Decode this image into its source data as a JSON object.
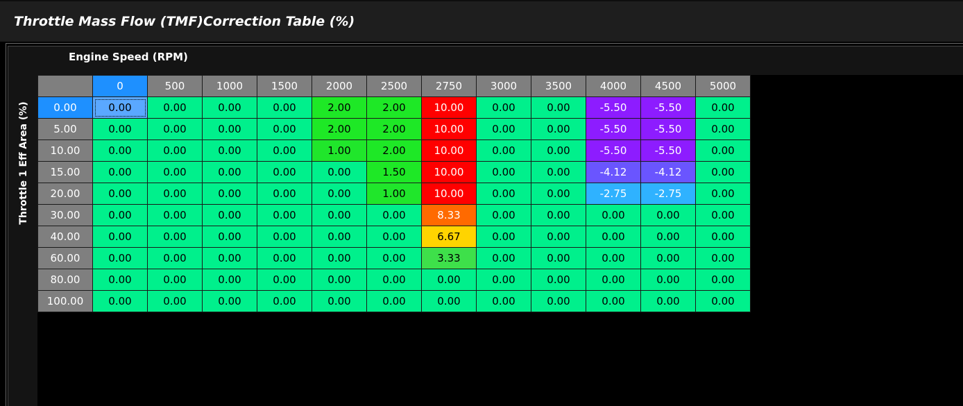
{
  "title": "Throttle Mass Flow (TMF)Correction Table (%)",
  "x_axis_label": "Engine Speed (RPM)",
  "y_axis_label": "Throttle 1 Eff Area (%)",
  "selected_column_index": 0,
  "selected_row_index": 0,
  "colors": {
    "header_bg": "#7f7f7f",
    "selected_header_bg": "#1e90ff",
    "selected_cell_bg": "#5aa8ff"
  },
  "columns": [
    "0",
    "500",
    "1000",
    "1500",
    "2000",
    "2500",
    "2750",
    "3000",
    "3500",
    "4000",
    "4500",
    "5000"
  ],
  "rows": [
    {
      "label": "0.00",
      "values": [
        "0.00",
        "0.00",
        "0.00",
        "0.00",
        "2.00",
        "2.00",
        "10.00",
        "0.00",
        "0.00",
        "-5.50",
        "-5.50",
        "0.00"
      ]
    },
    {
      "label": "5.00",
      "values": [
        "0.00",
        "0.00",
        "0.00",
        "0.00",
        "2.00",
        "2.00",
        "10.00",
        "0.00",
        "0.00",
        "-5.50",
        "-5.50",
        "0.00"
      ]
    },
    {
      "label": "10.00",
      "values": [
        "0.00",
        "0.00",
        "0.00",
        "0.00",
        "1.00",
        "2.00",
        "10.00",
        "0.00",
        "0.00",
        "-5.50",
        "-5.50",
        "0.00"
      ]
    },
    {
      "label": "15.00",
      "values": [
        "0.00",
        "0.00",
        "0.00",
        "0.00",
        "0.00",
        "1.50",
        "10.00",
        "0.00",
        "0.00",
        "-4.12",
        "-4.12",
        "0.00"
      ]
    },
    {
      "label": "20.00",
      "values": [
        "0.00",
        "0.00",
        "0.00",
        "0.00",
        "0.00",
        "1.00",
        "10.00",
        "0.00",
        "0.00",
        "-2.75",
        "-2.75",
        "0.00"
      ]
    },
    {
      "label": "30.00",
      "values": [
        "0.00",
        "0.00",
        "0.00",
        "0.00",
        "0.00",
        "0.00",
        "8.33",
        "0.00",
        "0.00",
        "0.00",
        "0.00",
        "0.00"
      ]
    },
    {
      "label": "40.00",
      "values": [
        "0.00",
        "0.00",
        "0.00",
        "0.00",
        "0.00",
        "0.00",
        "6.67",
        "0.00",
        "0.00",
        "0.00",
        "0.00",
        "0.00"
      ]
    },
    {
      "label": "60.00",
      "values": [
        "0.00",
        "0.00",
        "0.00",
        "0.00",
        "0.00",
        "0.00",
        "3.33",
        "0.00",
        "0.00",
        "0.00",
        "0.00",
        "0.00"
      ]
    },
    {
      "label": "80.00",
      "values": [
        "0.00",
        "0.00",
        "0.00",
        "0.00",
        "0.00",
        "0.00",
        "0.00",
        "0.00",
        "0.00",
        "0.00",
        "0.00",
        "0.00"
      ]
    },
    {
      "label": "100.00",
      "values": [
        "0.00",
        "0.00",
        "0.00",
        "0.00",
        "0.00",
        "0.00",
        "0.00",
        "0.00",
        "0.00",
        "0.00",
        "0.00",
        "0.00"
      ]
    }
  ]
}
